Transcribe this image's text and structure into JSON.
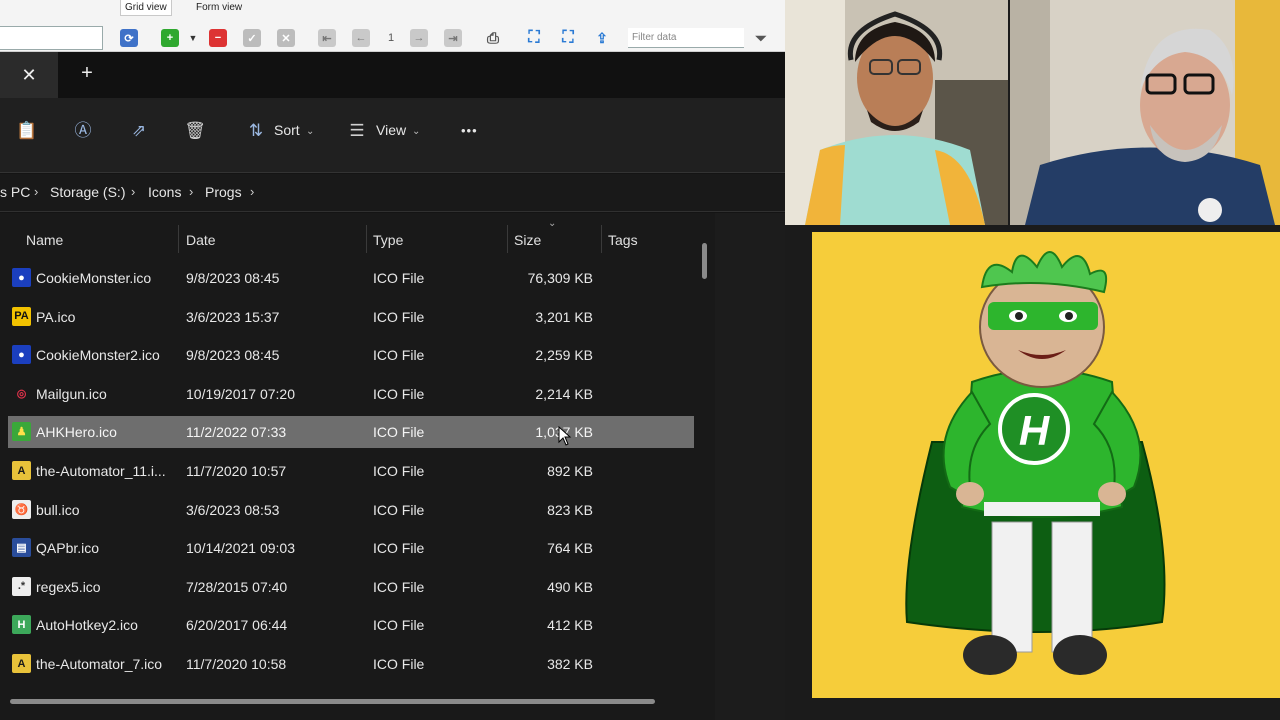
{
  "gridbar": {
    "tabs": [
      "Grid view",
      "Form view"
    ],
    "page_number": "1",
    "filter_placeholder": "Filter data"
  },
  "explorer": {
    "toolbar": {
      "sort_label": "Sort",
      "view_label": "View",
      "more_label": "•••"
    },
    "breadcrumb": [
      "s PC",
      "Storage (S:)",
      "Icons",
      "Progs"
    ],
    "columns": [
      "Name",
      "Date",
      "Type",
      "Size",
      "Tags"
    ],
    "files": [
      {
        "name": "CookieMonster.ico",
        "date": "9/8/2023 08:45",
        "type": "ICO File",
        "size": "76,309 KB"
      },
      {
        "name": "PA.ico",
        "date": "3/6/2023 15:37",
        "type": "ICO File",
        "size": "3,201 KB"
      },
      {
        "name": "CookieMonster2.ico",
        "date": "9/8/2023 08:45",
        "type": "ICO File",
        "size": "2,259 KB"
      },
      {
        "name": "Mailgun.ico",
        "date": "10/19/2017 07:20",
        "type": "ICO File",
        "size": "2,214 KB"
      },
      {
        "name": "AHKHero.ico",
        "date": "11/2/2022 07:33",
        "type": "ICO File",
        "size": "1,037 KB"
      },
      {
        "name": "the-Automator_11.i...",
        "date": "11/7/2020 10:57",
        "type": "ICO File",
        "size": "892 KB"
      },
      {
        "name": "bull.ico",
        "date": "3/6/2023 08:53",
        "type": "ICO File",
        "size": "823 KB"
      },
      {
        "name": "QAPbr.ico",
        "date": "10/14/2021 09:03",
        "type": "ICO File",
        "size": "764 KB"
      },
      {
        "name": "regex5.ico",
        "date": "7/28/2015 07:40",
        "type": "ICO File",
        "size": "490 KB"
      },
      {
        "name": "AutoHotkey2.ico",
        "date": "6/20/2017 06:44",
        "type": "ICO File",
        "size": "412 KB"
      },
      {
        "name": "the-Automator_7.ico",
        "date": "11/7/2020 10:58",
        "type": "ICO File",
        "size": "382 KB"
      }
    ],
    "selected_index": 4
  },
  "file_icons": [
    "cookie-monster-icon",
    "pa-icon",
    "cookie-monster-icon",
    "mailgun-icon",
    "ahk-hero-icon",
    "automator-icon",
    "bull-icon",
    "qap-icon",
    "regex-icon",
    "autohotkey-icon",
    "automator-icon"
  ],
  "colors": {
    "selected_row": "#6e6e6e",
    "hero_background": "#f6cd3a",
    "hero_green": "#2db52d"
  }
}
